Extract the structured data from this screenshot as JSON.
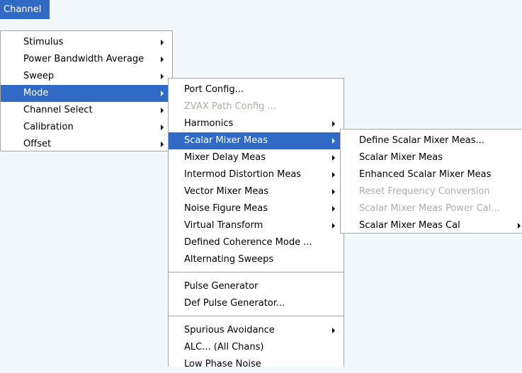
{
  "menubar": {
    "channel_label": "Channel"
  },
  "channel_menu": {
    "items": [
      {
        "label": "Stimulus"
      },
      {
        "label": "Power Bandwidth Average"
      },
      {
        "label": "Sweep"
      },
      {
        "label": "Mode"
      },
      {
        "label": "Channel Select"
      },
      {
        "label": "Calibration"
      },
      {
        "label": "Offset"
      }
    ]
  },
  "mode_menu": {
    "items": [
      {
        "label": "Port Config..."
      },
      {
        "label": "ZVAX Path Config ..."
      },
      {
        "label": "Harmonics"
      },
      {
        "label": "Scalar Mixer Meas"
      },
      {
        "label": "Mixer Delay Meas"
      },
      {
        "label": "Intermod Distortion Meas"
      },
      {
        "label": "Vector Mixer Meas"
      },
      {
        "label": "Noise Figure Meas"
      },
      {
        "label": "Virtual Transform"
      },
      {
        "label": "Defined Coherence Mode ..."
      },
      {
        "label": "Alternating Sweeps"
      },
      {
        "label": "Pulse Generator"
      },
      {
        "label": "Def Pulse Generator..."
      },
      {
        "label": "Spurious Avoidance"
      },
      {
        "label": "ALC... (All Chans)"
      },
      {
        "label": "Low Phase Noise"
      }
    ]
  },
  "scalar_menu": {
    "items": [
      {
        "label": "Define Scalar Mixer Meas..."
      },
      {
        "label": "Scalar Mixer Meas"
      },
      {
        "label": "Enhanced Scalar Mixer Meas"
      },
      {
        "label": "Reset Frequency Conversion"
      },
      {
        "label": "Scalar Mixer Meas Power Cal..."
      },
      {
        "label": "Scalar Mixer Meas Cal"
      }
    ]
  },
  "colors": {
    "highlight": "#316ac5",
    "disabled_text": "#acaca8",
    "menu_background": "#ffffff",
    "menu_border": "#a7a6aa",
    "page_background": "#f3f8fc"
  }
}
